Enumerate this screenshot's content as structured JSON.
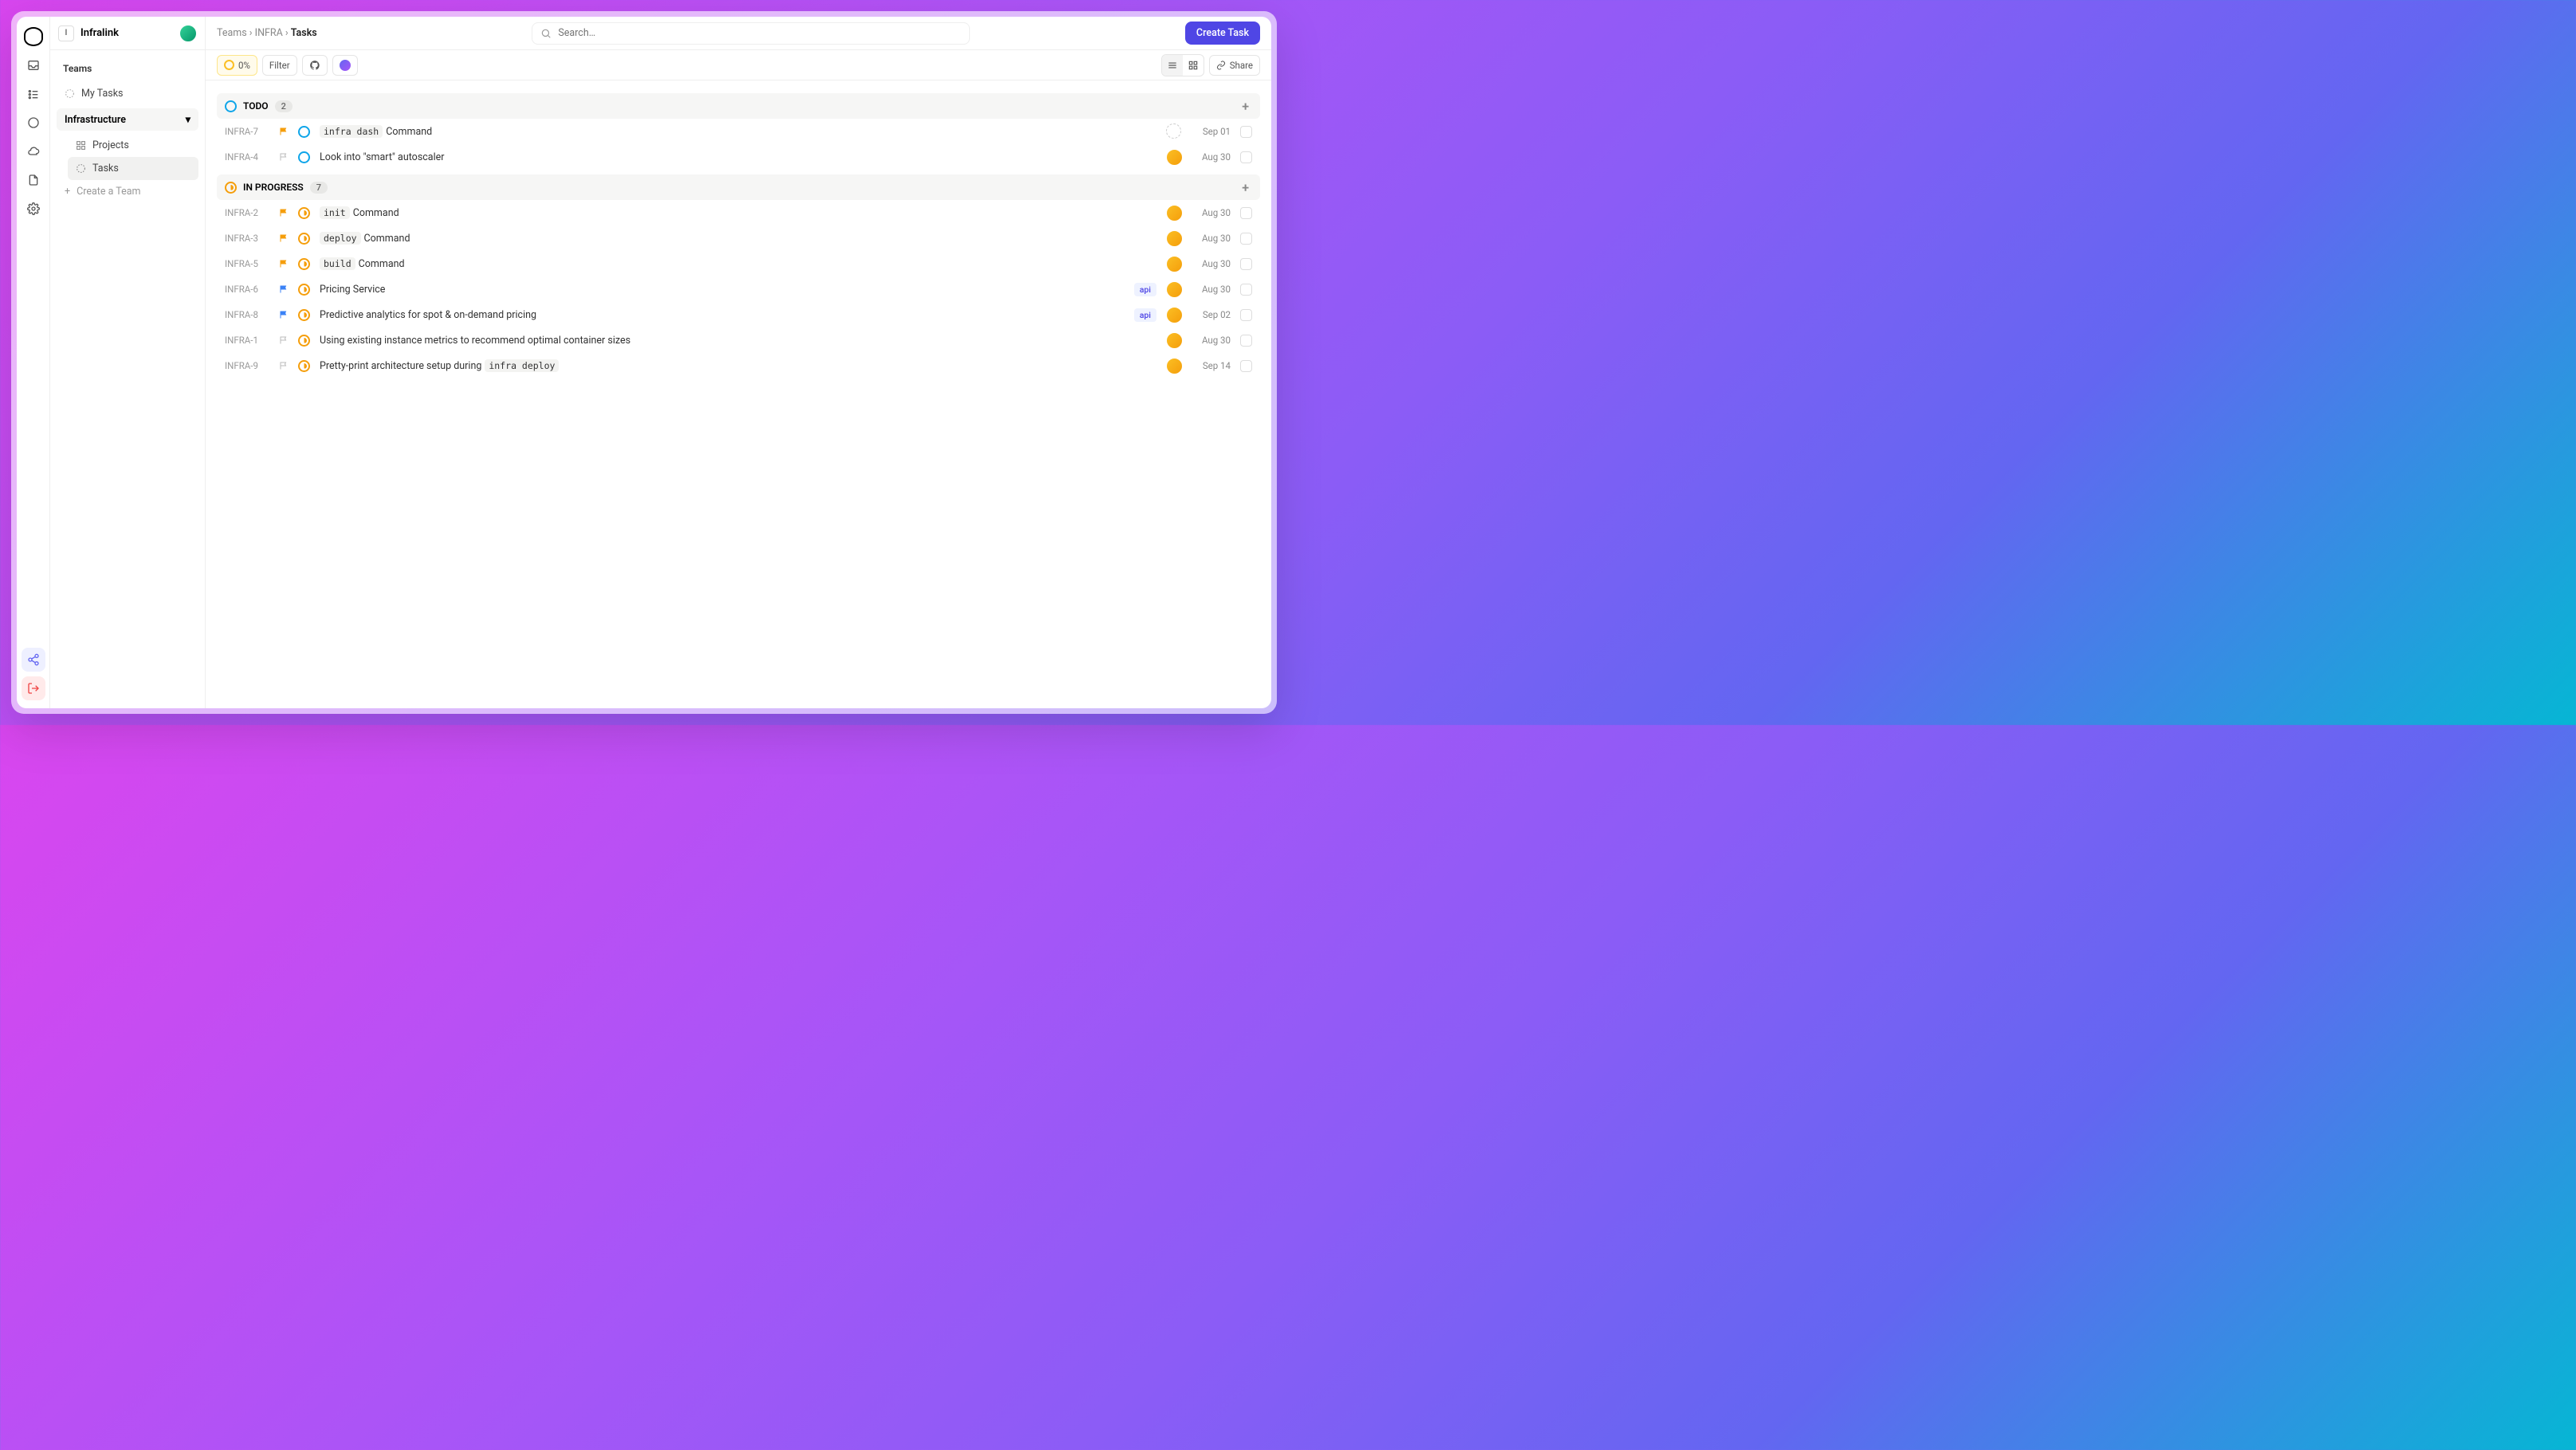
{
  "workspace": {
    "badge": "I",
    "name": "Infralink"
  },
  "sidebar": {
    "heading": "Teams",
    "my_tasks": "My Tasks",
    "section": "Infrastructure",
    "projects": "Projects",
    "tasks": "Tasks",
    "create": "Create a Team"
  },
  "breadcrumb": {
    "a": "Teams",
    "b": "INFRA",
    "c": "Tasks"
  },
  "search_placeholder": "Search…",
  "create_button": "Create Task",
  "toolbar": {
    "percent": "0%",
    "filter": "Filter",
    "share": "Share"
  },
  "groups": [
    {
      "key": "todo",
      "label": "TODO",
      "count": "2",
      "statusClass": "todo",
      "tasks": [
        {
          "id": "INFRA-7",
          "flag": "orange",
          "status": "todo",
          "pre": "infra dash",
          "post": "Command",
          "tag": "",
          "assignee": "none",
          "date": "Sep 01"
        },
        {
          "id": "INFRA-4",
          "flag": "none",
          "status": "todo",
          "pre": "",
          "post": "Look into \"smart\" autoscaler",
          "tag": "",
          "assignee": "u1",
          "date": "Aug 30"
        }
      ]
    },
    {
      "key": "prog",
      "label": "IN PROGRESS",
      "count": "7",
      "statusClass": "prog",
      "tasks": [
        {
          "id": "INFRA-2",
          "flag": "orange",
          "status": "prog",
          "pre": "init",
          "post": "Command",
          "tag": "",
          "assignee": "u1",
          "date": "Aug 30"
        },
        {
          "id": "INFRA-3",
          "flag": "orange",
          "status": "prog",
          "pre": "deploy",
          "post": "Command",
          "tag": "",
          "assignee": "u1",
          "date": "Aug 30"
        },
        {
          "id": "INFRA-5",
          "flag": "orange",
          "status": "prog",
          "pre": "build",
          "post": "Command",
          "tag": "",
          "assignee": "u1",
          "date": "Aug 30"
        },
        {
          "id": "INFRA-6",
          "flag": "blue",
          "status": "prog",
          "pre": "",
          "post": "Pricing Service",
          "tag": "api",
          "assignee": "u1",
          "date": "Aug 30"
        },
        {
          "id": "INFRA-8",
          "flag": "blue",
          "status": "prog",
          "pre": "",
          "post": "Predictive analytics for spot & on-demand pricing",
          "tag": "api",
          "assignee": "u1",
          "date": "Sep 02"
        },
        {
          "id": "INFRA-1",
          "flag": "none",
          "status": "prog",
          "pre": "",
          "post": "Using existing instance metrics to recommend optimal container sizes",
          "tag": "",
          "assignee": "u1",
          "date": "Aug 30"
        },
        {
          "id": "INFRA-9",
          "flag": "none",
          "status": "prog",
          "pre": "",
          "post_before": "Pretty-print architecture setup during ",
          "post_code": "infra deploy",
          "tag": "",
          "assignee": "u1",
          "date": "Sep 14"
        }
      ]
    }
  ]
}
